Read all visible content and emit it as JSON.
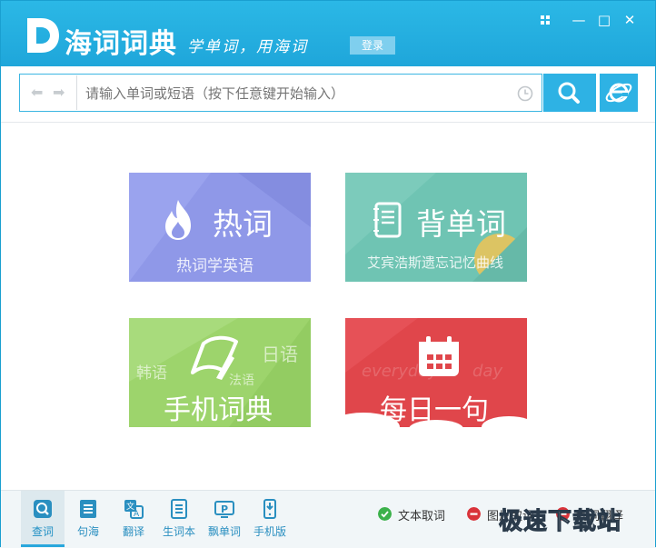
{
  "app": {
    "name": "海词词典",
    "slogan": "学单词，用海词",
    "login_label": "登录"
  },
  "window_controls": {
    "skin_icon": "grid-icon",
    "minimize": "—",
    "maximize": "□",
    "close": "✕"
  },
  "search": {
    "placeholder": "请输入单词或短语（按下任意键开始输入）",
    "value": ""
  },
  "tiles": [
    {
      "title": "热词",
      "subtitle": "热词学英语",
      "icon": "flame-icon",
      "color": "#8f98e8"
    },
    {
      "title": "背单词",
      "subtitle": "艾宾浩斯遗忘记忆曲线",
      "icon": "notebook-icon",
      "color": "#6fc4b3"
    },
    {
      "title": "手机词典",
      "tags": [
        "韩语",
        "法语",
        "日语"
      ],
      "icon": "pen-book-icon",
      "color": "#9dd46c"
    },
    {
      "title": "每日一句",
      "bg_text": "everyday",
      "bg_text2": "day",
      "icon": "calendar-icon",
      "color": "#e0464b"
    }
  ],
  "bottom_tabs": [
    {
      "label": "查词",
      "icon": "lookup-icon",
      "active": true
    },
    {
      "label": "句海",
      "icon": "sentence-icon",
      "active": false
    },
    {
      "label": "翻译",
      "icon": "translate-icon",
      "active": false
    },
    {
      "label": "生词本",
      "icon": "wordbook-icon",
      "active": false
    },
    {
      "label": "飘单词",
      "icon": "floating-word-icon",
      "active": false
    },
    {
      "label": "手机版",
      "icon": "mobile-icon",
      "active": false
    }
  ],
  "toggles": [
    {
      "label": "文本取词",
      "state": "on",
      "color": "#3bb14a"
    },
    {
      "label": "图片取词",
      "state": "off",
      "color": "#d9333a"
    },
    {
      "label": "划词翻译",
      "state": "off",
      "color": "#d9333a"
    }
  ],
  "watermark": "极速下载站"
}
